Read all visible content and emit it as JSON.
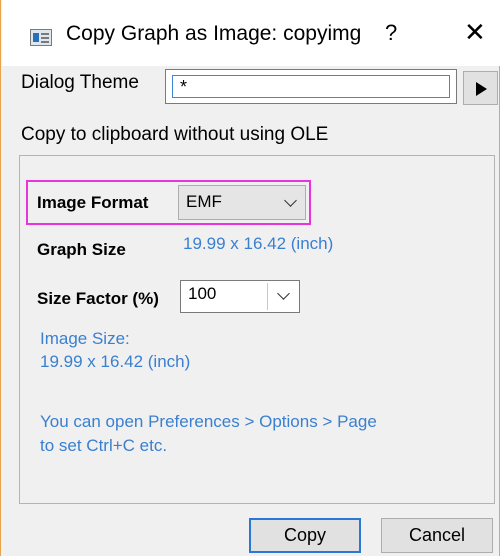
{
  "window": {
    "title": "Copy Graph as Image: copyimg",
    "help_label": "?",
    "close_label": "✕"
  },
  "theme": {
    "label": "Dialog Theme",
    "value": "*",
    "arrow_icon": "play-triangle-icon"
  },
  "ole_text": "Copy to clipboard without using OLE",
  "group": {
    "image_format_label": "Image Format",
    "image_format_value": "EMF",
    "graph_size_label": "Graph Size",
    "graph_size_value": "19.99 x 16.42 (inch)",
    "size_factor_label": "Size Factor (%)",
    "size_factor_value": "100",
    "image_size_line1": "Image Size:",
    "image_size_line2": "19.99 x 16.42 (inch)",
    "hint_line1": "You can open Preferences > Options > Page",
    "hint_line2": "to set Ctrl+C etc."
  },
  "buttons": {
    "copy": "Copy",
    "cancel": "Cancel"
  },
  "colors": {
    "border_accent": "#e8a34b",
    "highlight": "#e933e0",
    "info_text": "#3a7fd0",
    "default_button_border": "#2a78d4"
  }
}
